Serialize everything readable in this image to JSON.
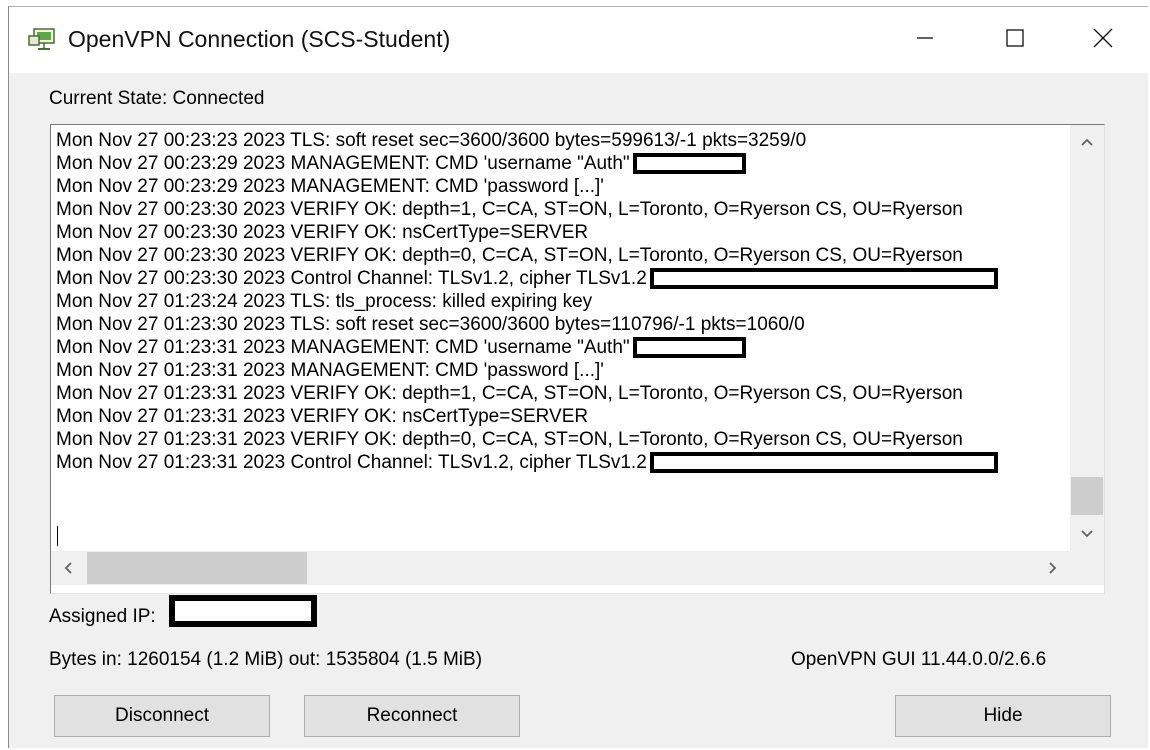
{
  "window": {
    "title": "OpenVPN Connection (SCS-Student)"
  },
  "status": {
    "current_state": "Current State: Connected"
  },
  "log": {
    "lines": [
      {
        "text": "Mon Nov 27 00:23:23 2023 TLS: soft reset sec=3600/3600 bytes=599613/-1 pkts=3259/0",
        "redacted": false
      },
      {
        "text": "Mon Nov 27 00:23:29 2023 MANAGEMENT: CMD 'username \"Auth\"",
        "redacted": true
      },
      {
        "text": "Mon Nov 27 00:23:29 2023 MANAGEMENT: CMD 'password [...]'",
        "redacted": false
      },
      {
        "text": "Mon Nov 27 00:23:30 2023 VERIFY OK: depth=1, C=CA, ST=ON, L=Toronto, O=Ryerson CS, OU=Ryerson",
        "redacted": false
      },
      {
        "text": "Mon Nov 27 00:23:30 2023 VERIFY OK: nsCertType=SERVER",
        "redacted": false
      },
      {
        "text": "Mon Nov 27 00:23:30 2023 VERIFY OK: depth=0, C=CA, ST=ON, L=Toronto, O=Ryerson CS, OU=Ryerson",
        "redacted": false
      },
      {
        "text": "Mon Nov 27 00:23:30 2023 Control Channel: TLSv1.2, cipher TLSv1.2",
        "redacted": true
      },
      {
        "text": "Mon Nov 27 01:23:24 2023 TLS: tls_process: killed expiring key",
        "redacted": false
      },
      {
        "text": "Mon Nov 27 01:23:30 2023 TLS: soft reset sec=3600/3600 bytes=110796/-1 pkts=1060/0",
        "redacted": false
      },
      {
        "text": "Mon Nov 27 01:23:31 2023 MANAGEMENT: CMD 'username \"Auth\"",
        "redacted": true
      },
      {
        "text": "Mon Nov 27 01:23:31 2023 MANAGEMENT: CMD 'password [...]'",
        "redacted": false
      },
      {
        "text": "Mon Nov 27 01:23:31 2023 VERIFY OK: depth=1, C=CA, ST=ON, L=Toronto, O=Ryerson CS, OU=Ryerson",
        "redacted": false
      },
      {
        "text": "Mon Nov 27 01:23:31 2023 VERIFY OK: nsCertType=SERVER",
        "redacted": false
      },
      {
        "text": "Mon Nov 27 01:23:31 2023 VERIFY OK: depth=0, C=CA, ST=ON, L=Toronto, O=Ryerson CS, OU=Ryerson",
        "redacted": false
      },
      {
        "text": "Mon Nov 27 01:23:31 2023 Control Channel: TLSv1.2, cipher TLSv1.2",
        "redacted": true
      }
    ]
  },
  "info": {
    "assigned_ip_label": "Assigned IP:",
    "bytes": "Bytes in: 1260154 (1.2 MiB)  out: 1535804 (1.5 MiB)",
    "version": "OpenVPN GUI 11.44.0.0/2.6.6"
  },
  "buttons": {
    "disconnect": "Disconnect",
    "reconnect": "Reconnect",
    "hide": "Hide"
  },
  "icons": {
    "app": "network-monitor-icon",
    "minimize": "minimize-icon",
    "maximize": "maximize-icon",
    "close": "close-icon"
  },
  "colors": {
    "window_bg": "#f0f0f0",
    "button_bg": "#e1e1e1",
    "scroll_thumb": "#cdcdcd"
  }
}
